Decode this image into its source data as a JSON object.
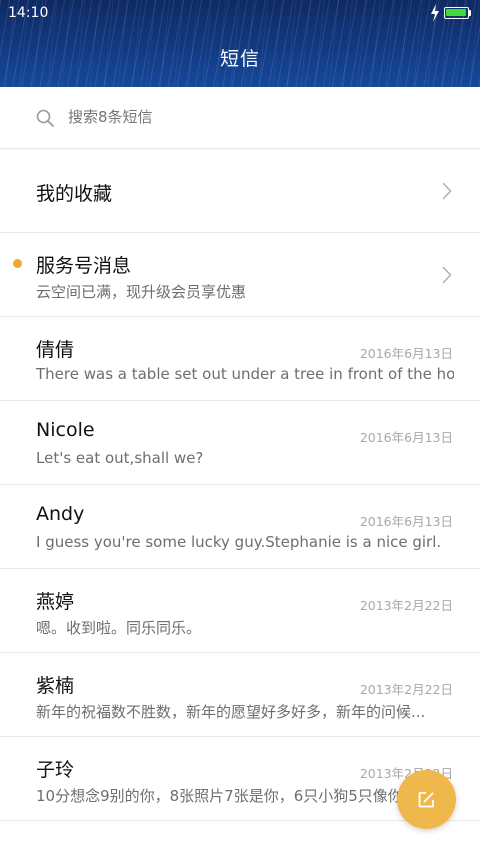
{
  "status_bar": {
    "time": "14:10",
    "battery_level": 1.0
  },
  "header": {
    "title": "短信"
  },
  "search": {
    "placeholder": "搜索8条短信"
  },
  "favorites": {
    "label": "我的收藏"
  },
  "service": {
    "name": "服务号消息",
    "preview": "云空间已满，现升级会员享优惠",
    "unread": true
  },
  "conversations": [
    {
      "name": "倩倩",
      "date": "2016年6月13日",
      "preview": "There was a table set out under a tree in front of the ho..."
    },
    {
      "name": "Nicole",
      "date": "2016年6月13日",
      "preview": "Let's eat out,shall we?"
    },
    {
      "name": "Andy",
      "date": "2016年6月13日",
      "preview": "I guess you're some lucky guy.Stephanie is a nice girl."
    },
    {
      "name": "燕婷",
      "date": "2013年2月22日",
      "preview": "嗯。收到啦。同乐同乐。"
    },
    {
      "name": "紫楠",
      "date": "2013年2月22日",
      "preview": "新年的祝福数不胜数，新年的愿望好多好多，新年的问候..."
    },
    {
      "name": "子玲",
      "date": "2013年2月22日",
      "preview": "10分想念9别的你，8张照片7张是你，6只小狗5只像你..."
    }
  ],
  "colors": {
    "accent": "#f0b84a",
    "unread_dot": "#f0a830",
    "header_bg": "#123a82"
  },
  "icons": {
    "search": "search-icon",
    "chevron": "chevron-right-icon",
    "compose": "compose-icon",
    "bolt": "charging-bolt-icon"
  }
}
